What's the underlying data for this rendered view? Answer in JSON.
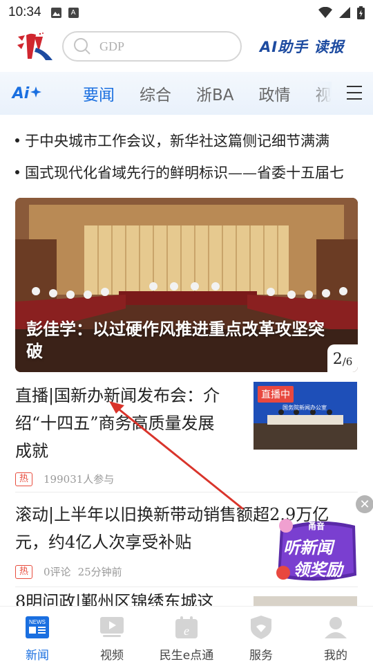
{
  "status_bar": {
    "time": "10:34",
    "icon_a": "A"
  },
  "header": {
    "search_placeholder": "GDP",
    "ai_label": "AI助手",
    "read_label": "读报"
  },
  "tabs": {
    "ai_label": "Ai",
    "items": [
      "要闻",
      "综合",
      "浙BA",
      "政情",
      "视"
    ],
    "active_index": 0
  },
  "ticker": [
    "于中央城市工作会议，新华社这篇侧记细节满满",
    "国式现代化省域先行的鲜明标识——省委十五届七"
  ],
  "carousel": {
    "title": "彭佳学：以过硬作风推进重点改革攻坚突破",
    "page_current": "2",
    "page_total": "/6"
  },
  "news": [
    {
      "title": "直播|国新办新闻发布会：介绍“十四五”商务高质量发展成就",
      "tag": "热",
      "meta": [
        "199031人参与"
      ],
      "thumb_badge": "直播中",
      "thumb_caption": "国务院新闻办公室"
    },
    {
      "title": "滚动|上半年以旧换新带动销售额超2.9万亿元，约4亿人次享受补贴",
      "tag": "热",
      "meta": [
        "0评论",
        "25分钟前"
      ]
    },
    {
      "title": "8明问政|鄞州区锦绣东城这"
    }
  ],
  "float_widget": {
    "brand": "甬音",
    "line1": "听新闻",
    "line2": "领奖励",
    "close": "✕"
  },
  "bottom_nav": [
    {
      "label": "新闻",
      "icon": "news-icon"
    },
    {
      "label": "视频",
      "icon": "video-icon"
    },
    {
      "label": "民生e点通",
      "icon": "e-service-icon"
    },
    {
      "label": "服务",
      "icon": "service-icon"
    },
    {
      "label": "我的",
      "icon": "profile-icon"
    }
  ],
  "colors": {
    "accent": "#1a6fe0",
    "hot": "#e84c3d",
    "brand_red": "#d0262f",
    "arrow": "#d9342b"
  }
}
